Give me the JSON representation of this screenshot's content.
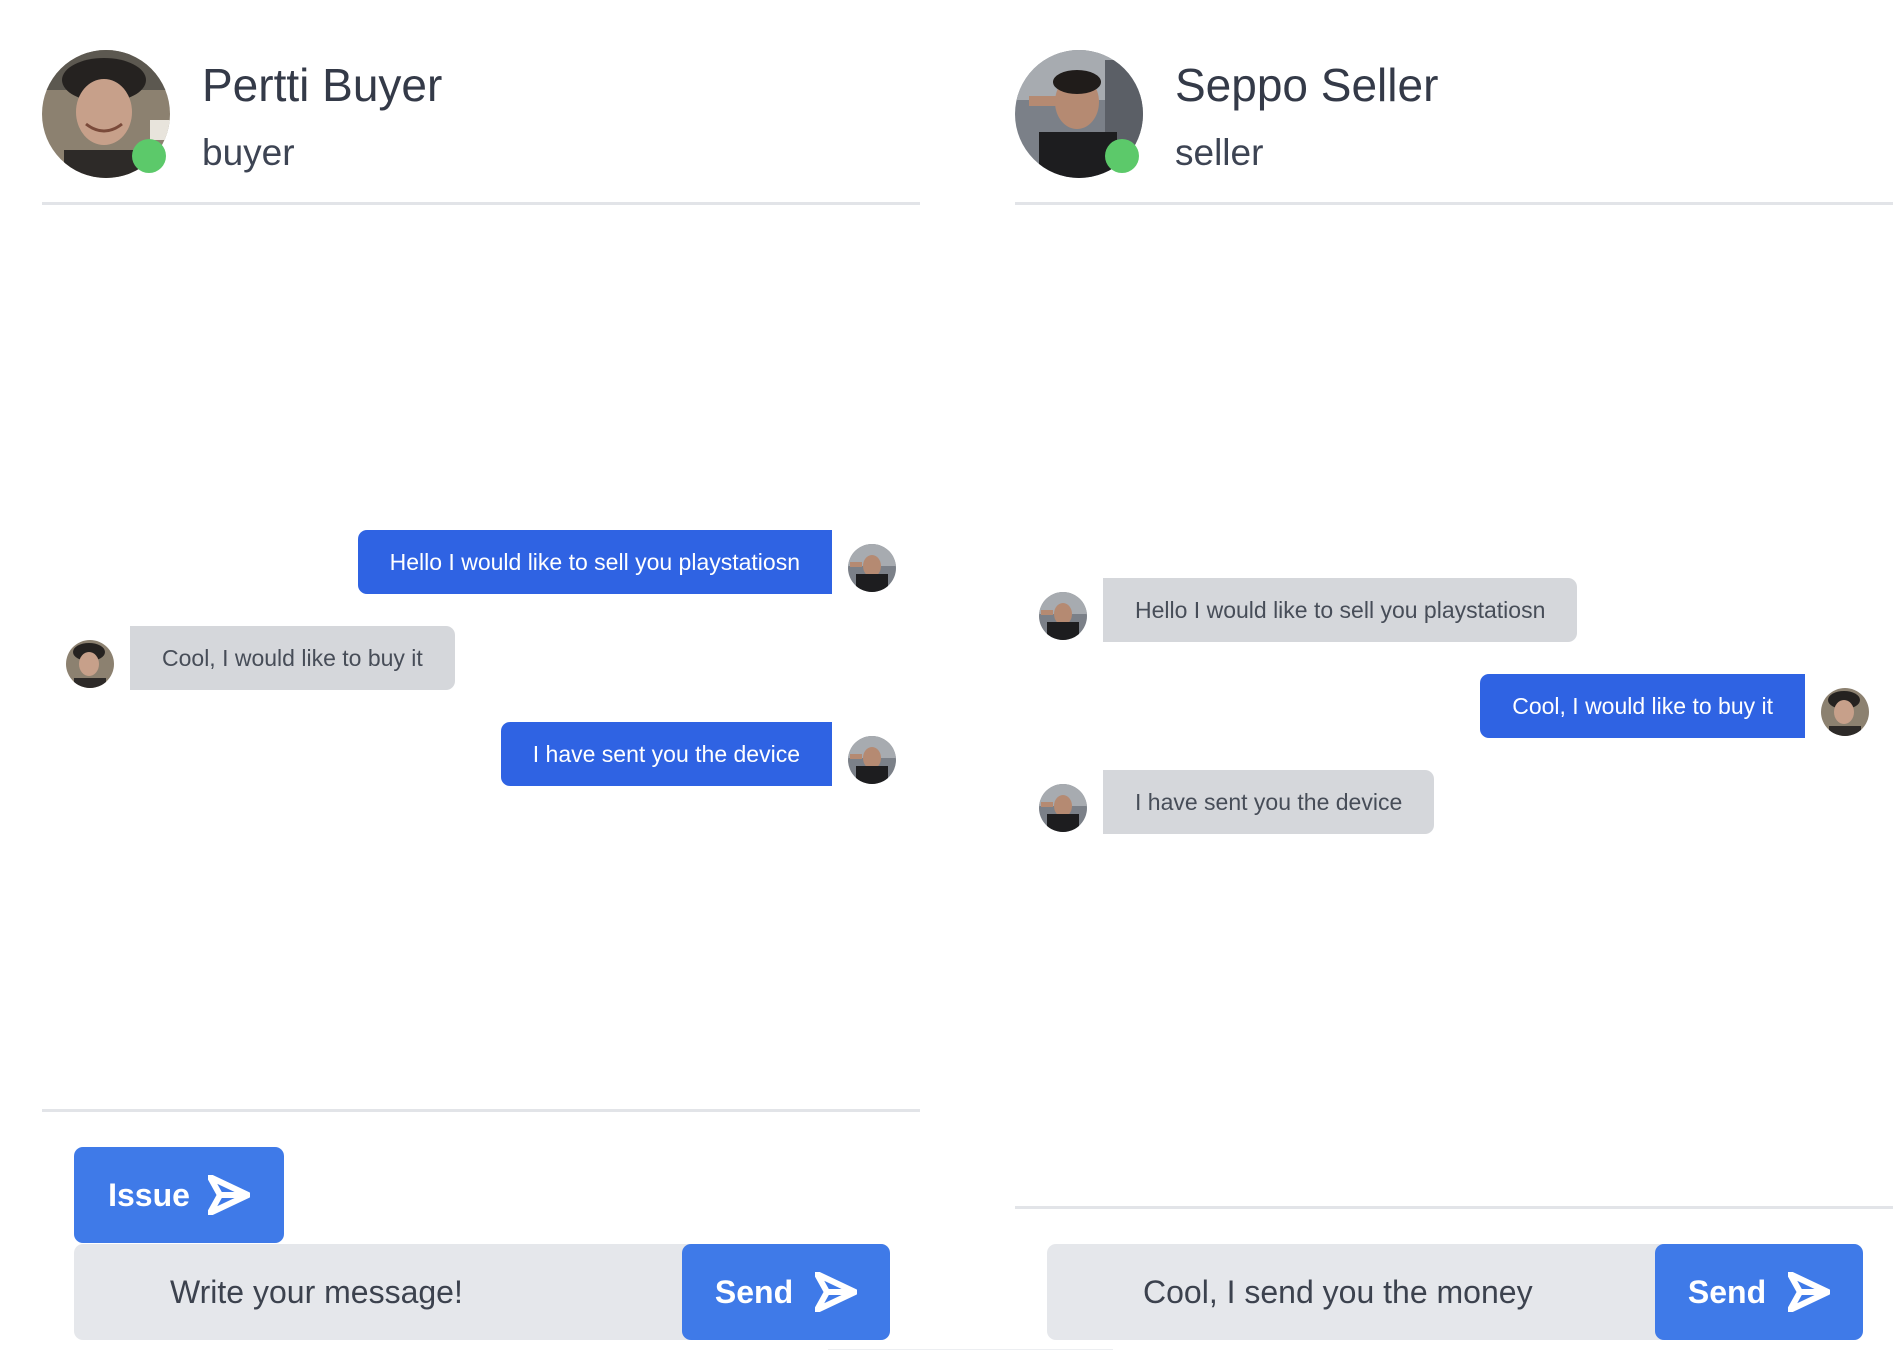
{
  "left_panel": {
    "user": {
      "name": "Pertti Buyer",
      "role": "buyer",
      "status": "online"
    },
    "messages": [
      {
        "text": "Hello I would like to sell you playstatiosn",
        "direction": "sent"
      },
      {
        "text": "Cool, I would like to buy it",
        "direction": "received"
      },
      {
        "text": "I have sent you the device",
        "direction": "sent"
      }
    ],
    "issue_label": "Issue",
    "input": {
      "value": "",
      "placeholder": "Write your message!"
    },
    "send_label": "Send"
  },
  "right_panel": {
    "user": {
      "name": "Seppo Seller",
      "role": "seller",
      "status": "online"
    },
    "messages": [
      {
        "text": "Hello I would like to sell you playstatiosn",
        "direction": "received"
      },
      {
        "text": "Cool, I would like to buy it",
        "direction": "sent"
      },
      {
        "text": "I have sent you the device",
        "direction": "received"
      }
    ],
    "input": {
      "value": "Cool, I send you the money",
      "placeholder": "Write your message!"
    },
    "send_label": "Send"
  },
  "colors": {
    "sent_bubble": "#2f63e3",
    "received_bubble": "#d5d7db",
    "button": "#3f7ae8",
    "online_dot": "#5cc96a",
    "input_background": "#e5e7eb"
  },
  "icons": [
    "send-arrow-icon",
    "online-status-icon"
  ]
}
